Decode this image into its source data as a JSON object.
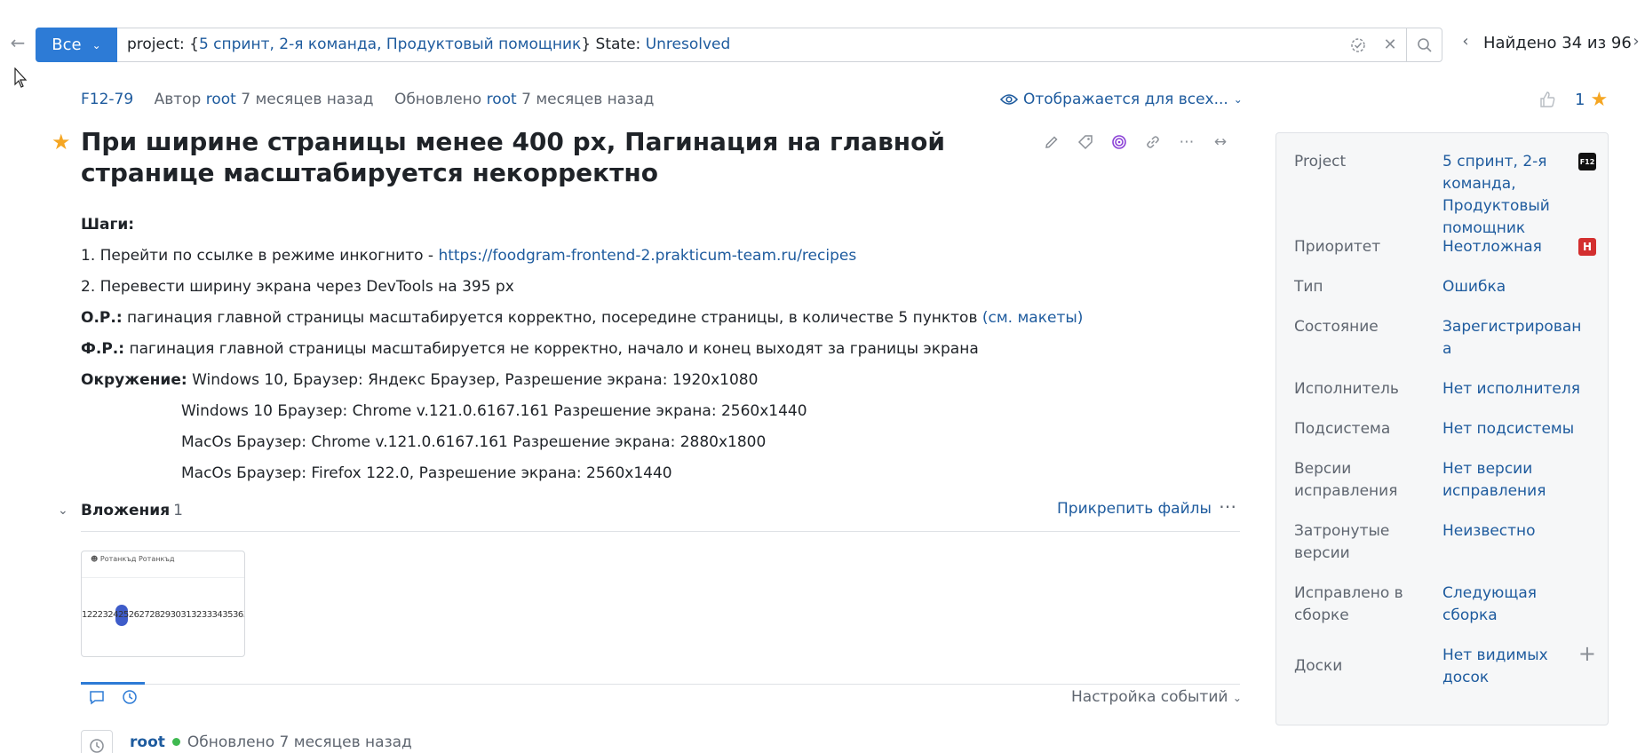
{
  "search": {
    "scope_label": "Все",
    "query_prefix": "project: {",
    "query_project": "5 спринт, 2-я команда, Продуктовый помощник",
    "query_mid": "} State: ",
    "query_state": "Unresolved",
    "found_text": "Найдено 34 из 96"
  },
  "issue": {
    "id": "F12-79",
    "author_prefix": "Автор",
    "author": "root",
    "author_time": "7 месяцев назад",
    "updated_prefix": "Обновлено",
    "updater": "root",
    "updated_time": "7 месяцев назад",
    "visibility": "Отображается для всех...",
    "star_count": "1",
    "title": "При ширине страницы менее 400 px, Пагинация на главной странице масштабируется некорректно"
  },
  "description": {
    "steps_label": "Шаги:",
    "step1_text": "1. Перейти по ссылке в режиме инкогнито - ",
    "step1_link": "https://foodgram-frontend-2.prakticum-team.ru/recipes",
    "step2_text": "2. Перевести ширину экрана через DevTools на 395 px",
    "expected_label": "О.Р.:",
    "expected_text": " пагинация главной страницы масштабируется корректно, посередине страницы, в количестве 5 пунктов ",
    "expected_link": "(см. макеты)",
    "actual_label": "Ф.Р.:",
    "actual_text": " пагинация главной страницы масштабируется не корректно, начало и конец выходят за границы экрана",
    "env_label": "Окружение:",
    "env_lines": [
      " Windows 10, Браузер: Яндекс Браузер, Разрешение экрана: 1920x1080",
      "Windows 10 Браузер: Chrome v.121.0.6167.161 Разрешение экрана: 2560x1440",
      "MacOs Браузер: Chrome v.121.0.6167.161 Разрешение экрана: 2880x1800",
      "MacOs Браузер: Firefox 122.0, Разрешение экрана: 2560x1440"
    ]
  },
  "attachments": {
    "title": "Вложения",
    "count": "1",
    "attach_label": "Прикрепить файлы",
    "thumb_header": "Ротанкъд Ротанкъд",
    "thumb_pages": "122232425262728293031323334353637"
  },
  "activity": {
    "events_label": "Настройка событий",
    "event_user": "root",
    "event_text": "Обновлено 7 месяцев назад"
  },
  "fields": {
    "project_label": "Project",
    "project_value": "5 спринт, 2-я команда, Продуктовый помощник",
    "project_badge": "F12",
    "priority_label": "Приоритет",
    "priority_value": "Неотложная",
    "priority_badge": "H",
    "type_label": "Тип",
    "type_value": "Ошибка",
    "state_label": "Состояние",
    "state_value": "Зарегистрирован а",
    "assignee_label": "Исполнитель",
    "assignee_value": "Нет исполнителя",
    "subsystem_label": "Подсистема",
    "subsystem_value": "Нет подсистемы",
    "fixversions_label": "Версии исправления",
    "fixversions_value": "Нет версии исправления",
    "affected_label": "Затронутые версии",
    "affected_value": "Неизвестно",
    "fixedbuild_label": "Исправлено в сборке",
    "fixedbuild_value": "Следующая сборка",
    "boards_label": "Доски",
    "boards_value": "Нет видимых досок"
  }
}
